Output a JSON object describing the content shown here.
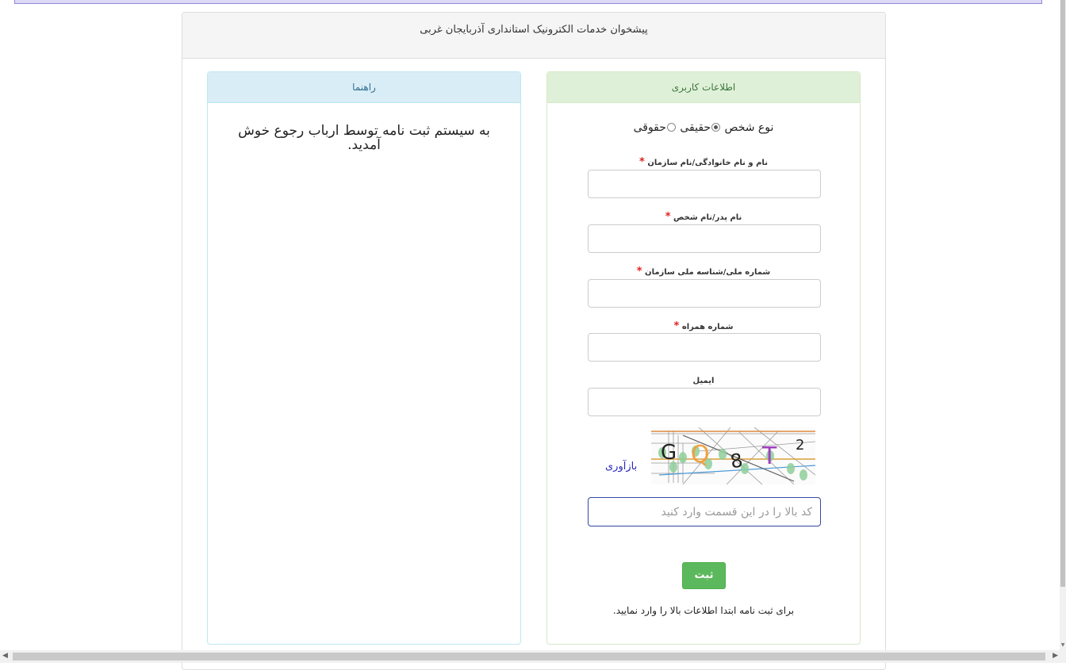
{
  "header": {
    "title": "پیشخوان خدمات الکترونیک استانداری آذربایجان غربی"
  },
  "guide": {
    "heading": "راهنما",
    "message": "به سیستم ثبت نامه توسط ارباب رجوع خوش آمدید."
  },
  "user_info": {
    "heading": "اطلاعات کاربری",
    "person_type_label": "نوع شخص",
    "option_real": "حقیقی",
    "option_legal": "حقوقی",
    "selected": "حقیقی",
    "fields": [
      {
        "label": "نام و نام خانوادگی/نام سازمان",
        "required_mark": "*",
        "value": ""
      },
      {
        "label": "نام پدر/نام شخص",
        "required_mark": "*",
        "value": ""
      },
      {
        "label": "شماره ملی/شناسه ملی سازمان",
        "required_mark": "*",
        "value": ""
      },
      {
        "label": "شماره همراه",
        "required_mark": "*",
        "value": ""
      },
      {
        "label": "ایمیل",
        "value": ""
      }
    ],
    "captcha_text": "GQ8T2",
    "refresh_label": "بازآوری",
    "captcha_placeholder": "کد بالا را در این قسمت وارد کنید",
    "submit_label": "ثبت",
    "note": "برای ثبت نامه ابتدا اطلاعات بالا را وارد نمایید."
  },
  "colors": {
    "success": "#5cb85c",
    "info_bg": "#d9edf7",
    "success_bg": "#dff0d8",
    "required": "#e02020"
  }
}
